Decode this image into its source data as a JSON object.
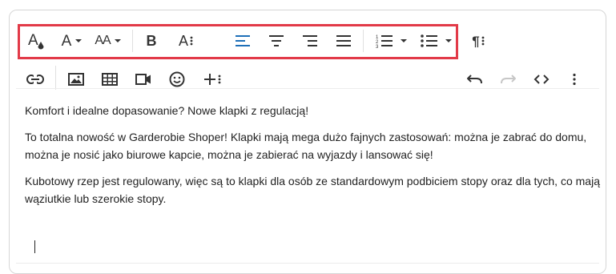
{
  "toolbar": {
    "font_color_label": "A",
    "font_family_label": "A",
    "font_size_label": "AA",
    "bold_label": "B",
    "more_text_label": "A",
    "paragraph_label": "¶"
  },
  "content": {
    "p1": "Komfort i idealne dopasowanie? Nowe klapki z regulacją!",
    "p2": "To totalna nowość w  Garderobie Shoper! Klapki mają mega dużo fajnych zastosowań: można je zabrać do domu, można je nosić jako biurowe kapcie, można je zabierać na wyjazdy i lansować się!",
    "p3": "Kubotowy rzep jest regulowany, więc są to klapki dla osób ze standardowym podbiciem stopy oraz dla tych, co mają wąziutkie lub szerokie stopy."
  },
  "colors": {
    "highlight": "#e23a48",
    "active_align": "#1e6fb8",
    "icon": "#333333"
  }
}
